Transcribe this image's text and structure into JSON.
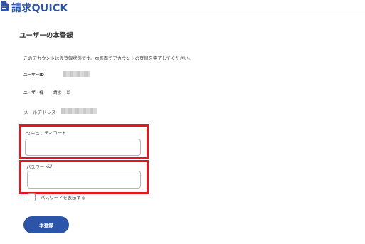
{
  "header": {
    "logo_text": "請求QUICK"
  },
  "page": {
    "title": "ユーザーの本登録",
    "notice": "このアカウントは仮登録状態です。本画面でアカウントの登録を完了してください。"
  },
  "fields": {
    "user_id_label": "ユーザーID",
    "user_name_label": "ユーザー名",
    "user_name_value": "請求 一郎",
    "email_label": "メールアドレス"
  },
  "form": {
    "security_code_label": "セキュリティコード",
    "security_code_value": "",
    "password_label": "パスワード",
    "password_value": "",
    "show_password_label": "パスワードを表示する",
    "submit_label": "本登録"
  },
  "colors": {
    "brand": "#2c54a8",
    "highlight": "#e5141f"
  },
  "icons": {
    "logo": "document-logo-icon",
    "password_info": "info-icon"
  }
}
